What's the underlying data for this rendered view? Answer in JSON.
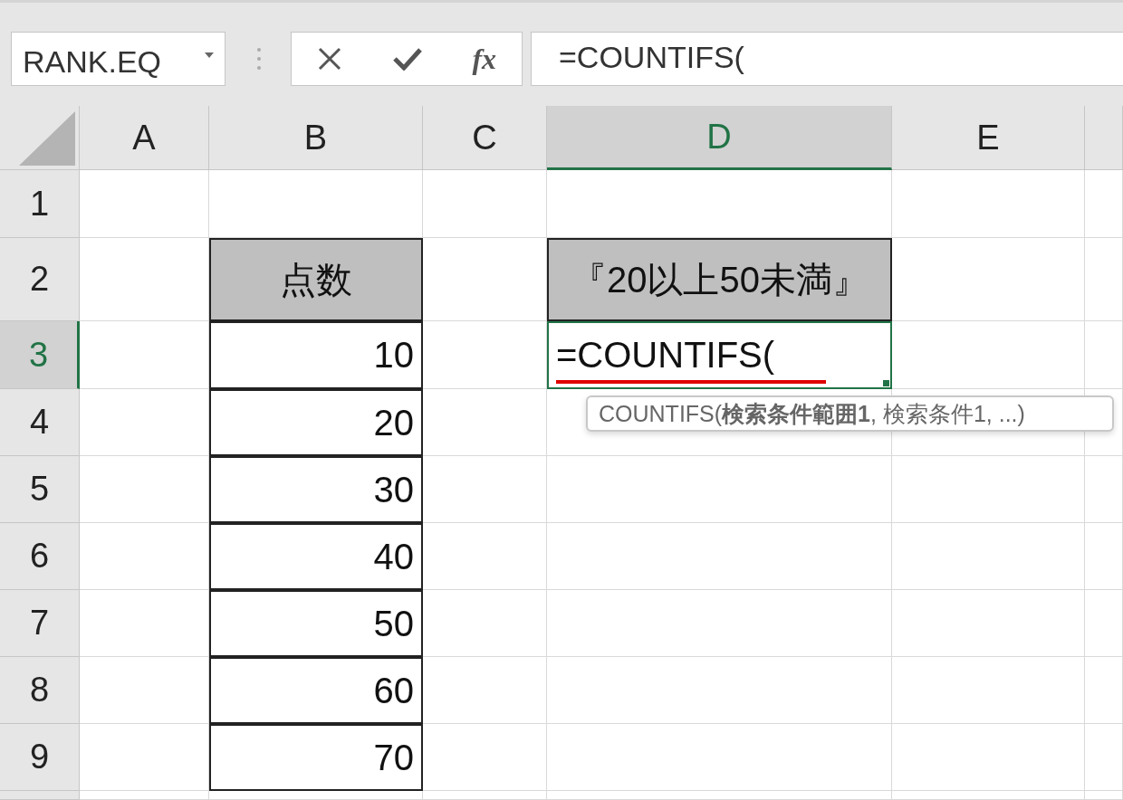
{
  "name_box": {
    "value": "RANK.EQ"
  },
  "formula_buttons": [
    {
      "kind": "cancel"
    },
    {
      "kind": "enter"
    },
    {
      "kind": "function",
      "label": "fx"
    }
  ],
  "formula_bar": {
    "value": "=COUNTIFS("
  },
  "columns": [
    {
      "label": "A",
      "selected": false
    },
    {
      "label": "B",
      "selected": false
    },
    {
      "label": "C",
      "selected": false
    },
    {
      "label": "D",
      "selected": true
    },
    {
      "label": "E",
      "selected": false
    }
  ],
  "rows": [
    {
      "number": "1",
      "selected": false
    },
    {
      "number": "2",
      "selected": false,
      "column_b": {
        "kind": "label",
        "text": "点数"
      },
      "column_d": {
        "kind": "label",
        "text": "『20以上50未満』"
      }
    },
    {
      "number": "3",
      "selected": true,
      "column_b": {
        "kind": "value",
        "text": "10"
      },
      "column_d": {
        "kind": "editing",
        "text": "=COUNTIFS("
      }
    },
    {
      "number": "4",
      "selected": false,
      "column_b": {
        "kind": "value",
        "text": "20"
      }
    },
    {
      "number": "5",
      "selected": false,
      "column_b": {
        "kind": "value",
        "text": "30"
      }
    },
    {
      "number": "6",
      "selected": false,
      "column_b": {
        "kind": "value",
        "text": "40"
      }
    },
    {
      "number": "7",
      "selected": false,
      "column_b": {
        "kind": "value",
        "text": "50"
      }
    },
    {
      "number": "8",
      "selected": false,
      "column_b": {
        "kind": "value",
        "text": "60"
      }
    },
    {
      "number": "9",
      "selected": false,
      "column_b": {
        "kind": "value",
        "text": "70"
      }
    }
  ],
  "tooltip": {
    "text": "COUNTIFS(**検索条件範囲1**, 検索条件1, ...)"
  }
}
